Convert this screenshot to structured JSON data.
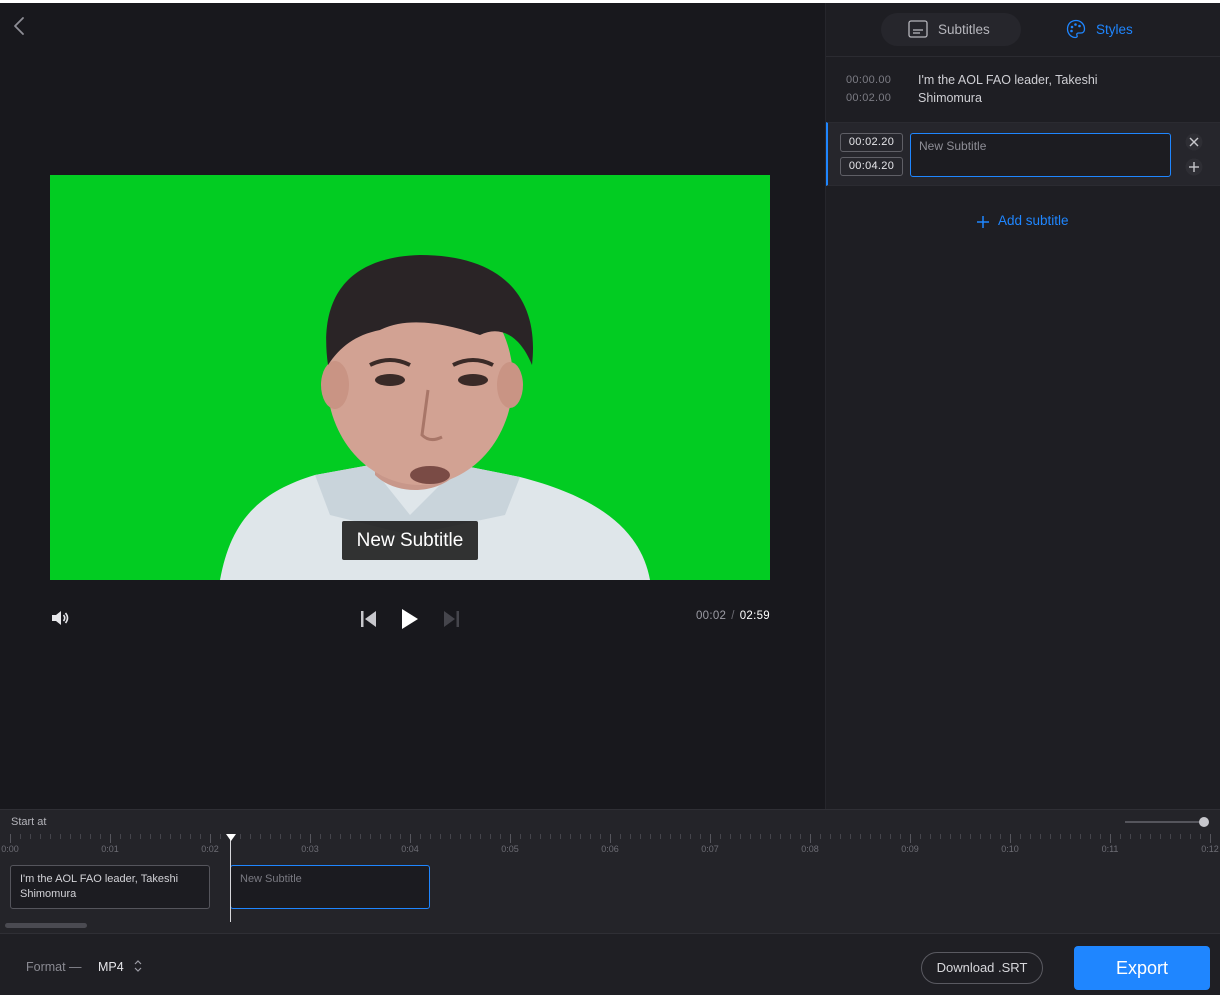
{
  "player": {
    "subtitle_overlay": "New Subtitle",
    "current_time": "00:02",
    "time_separator": "/",
    "total_time": "02:59"
  },
  "panel": {
    "tabs": [
      {
        "label": "Subtitles",
        "icon": "subtitles-icon"
      },
      {
        "label": "Styles",
        "icon": "palette-icon"
      }
    ],
    "active_tab": "Styles",
    "entries": [
      {
        "start": "00:00.00",
        "end": "00:02.00",
        "text": "I'm the AOL FAO leader, Takeshi Shimomura"
      },
      {
        "start": "00:02.20",
        "end": "00:04.20",
        "text": "",
        "placeholder": "New Subtitle"
      }
    ],
    "add_subtitle_label": "Add subtitle"
  },
  "timeline": {
    "label": "Start at",
    "ticks": [
      "0:00",
      "0:01",
      "0:02",
      "0:03",
      "0:04",
      "0:05",
      "0:06",
      "0:07",
      "0:08",
      "0:09",
      "0:10",
      "0:11",
      "0:12"
    ],
    "clips": [
      {
        "text": "I'm the AOL FAO leader, Takeshi Shimomura"
      },
      {
        "text": "New Subtitle"
      }
    ],
    "zoom_level": 1.0
  },
  "bottom": {
    "format_label": "Format —",
    "format_value": "MP4",
    "download_label": "Download .SRT",
    "export_label": "Export"
  },
  "colors": {
    "accent": "#1f86ff",
    "background": "#18181d",
    "green_screen": "#02cc22"
  }
}
